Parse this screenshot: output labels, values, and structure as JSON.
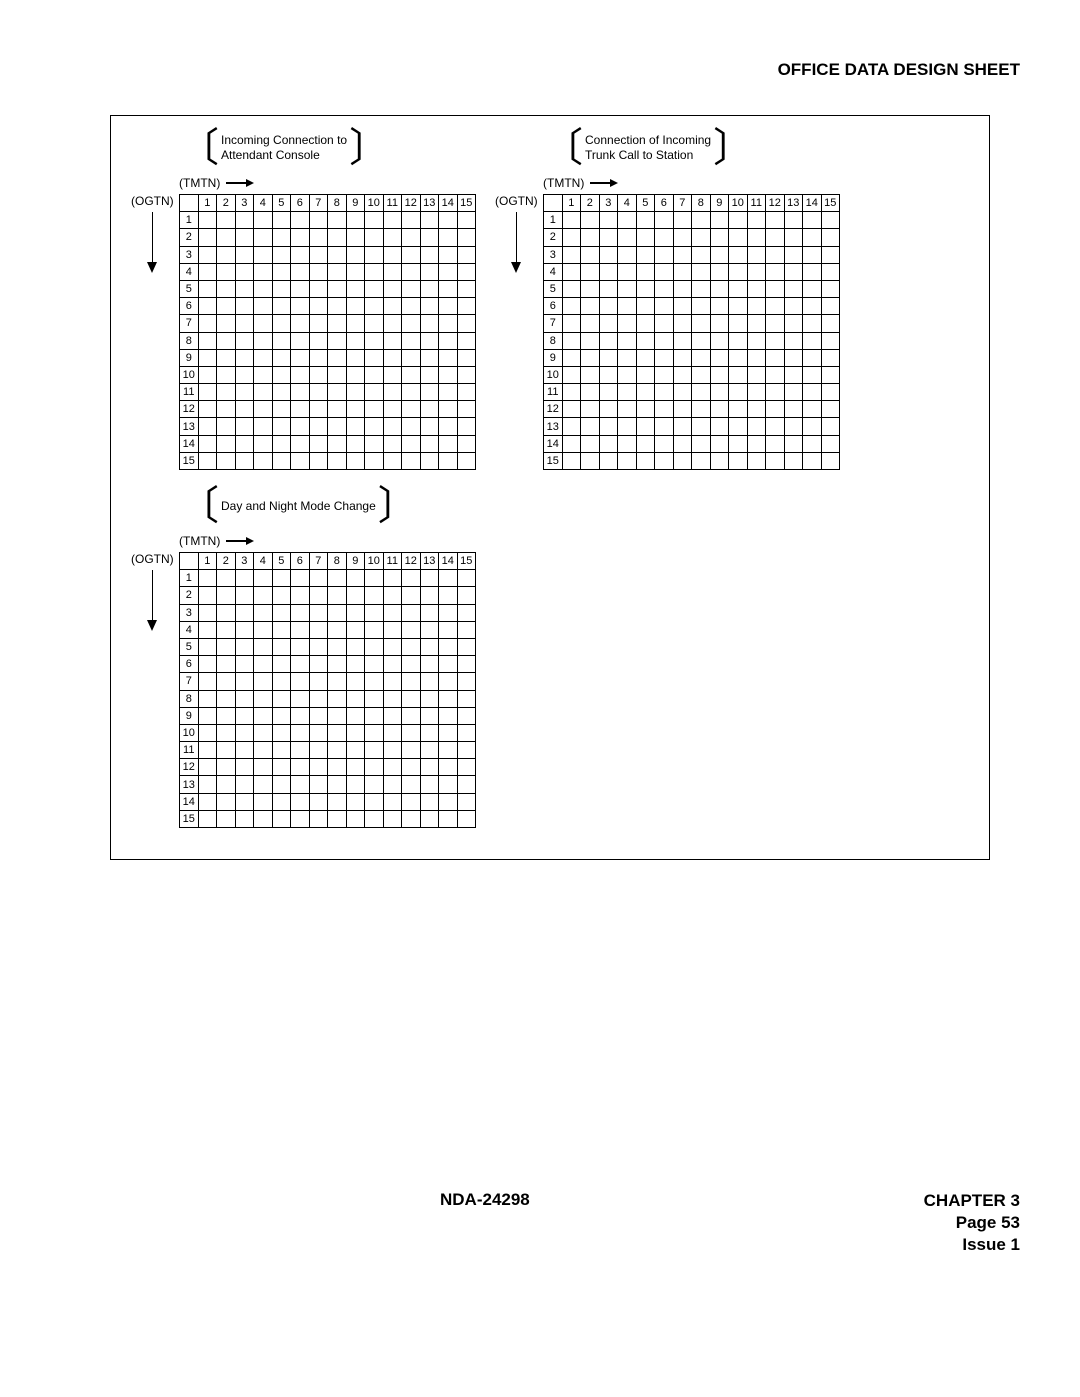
{
  "header": {
    "title": "OFFICE DATA DESIGN SHEET"
  },
  "sections": [
    {
      "id": "s1",
      "title_l1": "Incoming Connection to",
      "title_l2": "Attendant Console",
      "h_axis": "(TMTN)",
      "v_axis": "(OGTN)"
    },
    {
      "id": "s2",
      "title_l1": "Connection of Incoming",
      "title_l2": "Trunk Call to Station",
      "h_axis": "(TMTN)",
      "v_axis": "(OGTN)"
    },
    {
      "id": "s3",
      "title_l1": "Day and Night Mode Change",
      "title_l2": "",
      "h_axis": "(TMTN)",
      "v_axis": "(OGTN)"
    }
  ],
  "cols": [
    "1",
    "2",
    "3",
    "4",
    "5",
    "6",
    "7",
    "8",
    "9",
    "10",
    "11",
    "12",
    "13",
    "14",
    "15"
  ],
  "rows": [
    "1",
    "2",
    "3",
    "4",
    "5",
    "6",
    "7",
    "8",
    "9",
    "10",
    "11",
    "12",
    "13",
    "14",
    "15"
  ],
  "footer": {
    "doc": "NDA-24298",
    "chapter": "CHAPTER 3",
    "page": "Page 53",
    "issue": "Issue 1"
  }
}
